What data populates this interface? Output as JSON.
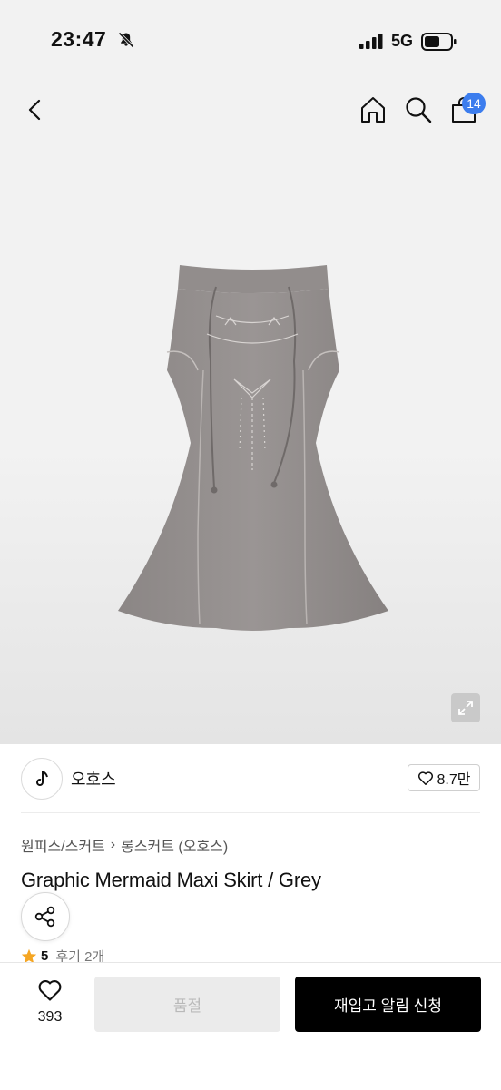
{
  "status_bar": {
    "time": "23:47",
    "network": "5G",
    "icons": [
      "bell-slash-icon",
      "signal-icon",
      "battery-icon"
    ]
  },
  "header": {
    "icons": [
      "back-icon",
      "home-icon",
      "search-icon",
      "cart-icon"
    ],
    "cart_badge": "14",
    "badge_color": "#3c7dee"
  },
  "product": {
    "image": "grey-mermaid-maxi-skirt",
    "expand_icon": "expand-icon"
  },
  "brand": {
    "name": "오호스",
    "like_count": "8.7만",
    "like_icon": "heart-icon"
  },
  "breadcrumb": {
    "category": "원피스/스커트",
    "subcategory": "롱스커트 (오호스)"
  },
  "title": "Graphic Mermaid Maxi Skirt / Grey",
  "rating": {
    "score": "5",
    "reviews": "후기 2개",
    "star_color": "#f5a623"
  },
  "bottom_bar": {
    "wish_count": "393",
    "soldout_label": "품절",
    "restock_label": "재입고 알림 신청"
  }
}
